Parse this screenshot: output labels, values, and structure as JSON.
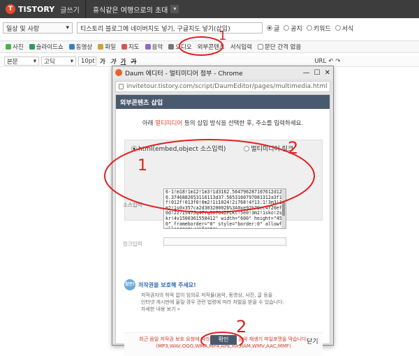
{
  "topbar": {
    "brand": "TISTORY",
    "write_label": "글쓰기",
    "blog_name": "휴식같은 여행으로의 초대"
  },
  "post": {
    "category": "일상 및 사랑",
    "title": "티스토리 블로그에 네이버지도 넣기, 구글지도 넣기(삽입)",
    "visibility_options": [
      "글",
      "공지",
      "키워드",
      "서식"
    ],
    "visibility_selected": "글"
  },
  "toolbar": {
    "items": [
      "사진",
      "슬라이드쇼",
      "동영상",
      "파일",
      "지도",
      "음악",
      "오디오",
      "외부콘텐츠",
      "서식입력",
      "문단 간격 없음"
    ]
  },
  "format_bar": {
    "paragraph": "본문",
    "font": "고딕",
    "size": "10pt",
    "url": "URL"
  },
  "dialog": {
    "window_title": "Daum 에디터 - 멀티미디어 첨부 - Chrome",
    "url": "invitetour.tistory.com/script/DaumEditor/pages/multimedia.html",
    "header": "외부콘텐츠 삽입",
    "instruction_prefix": "아래 ",
    "instruction_highlight": "멀티미디어",
    "instruction_suffix": " 등의 삽입 방식을 선택한 후, 주소를 입력하세요.",
    "option_html": "html(embed,object 소스입력)",
    "option_link": "멀티미디어 링크",
    "source_label": "소스입력",
    "source_code": "6-1!m18!1m12!1m3!1d3162.564796287107612d126.3746882653116113d37.5653160797081312a3f1f!012f!013f0!0m2!1i1024!2i768!4f13.1!3m3!1m2!1s0x357ca2d30320002b%3A0xe92b79ec4f20ef0d!2z7IS47Jq47Yq567O4ZFLKt!5e0!3m2!1sko!2skr!4v1500361558412\" width=\"600\" height=\"450\" frameborder=\"0\" style=\"border:0\" allowfullscreen></iframe>",
    "cut_label": "링크입력",
    "warning_badge": "잠깐!",
    "warning_title": "저작권을 보호해 주세요!",
    "desc_line1": "저작권자의 허락 없이 임의로 저작물(음악, 동영상, 사진, 글 등을",
    "desc_line2": "인터넷 게시판에 올릴 경우 관련 법령에 따라 처벌을 받을 수 있습니다.",
    "desc_more": "자세한 내용 보기 »",
    "notice_line1": "최근 음일 저작권 보호 요청에 따라, 부득이 외부 음악 재생기 파일포맷을 막습니다.",
    "notice_line2": "(MP3,WAV,OGG,WMA,MP4,APE,RA,RAM,WMV,AAC,MMF)",
    "confirm": "확인",
    "close": "닫기"
  },
  "annotations": {
    "mark1_top": "1",
    "mark1_left": "1",
    "mark2_right": "2",
    "mark2_bottom": "2",
    "color": "#e02020"
  }
}
